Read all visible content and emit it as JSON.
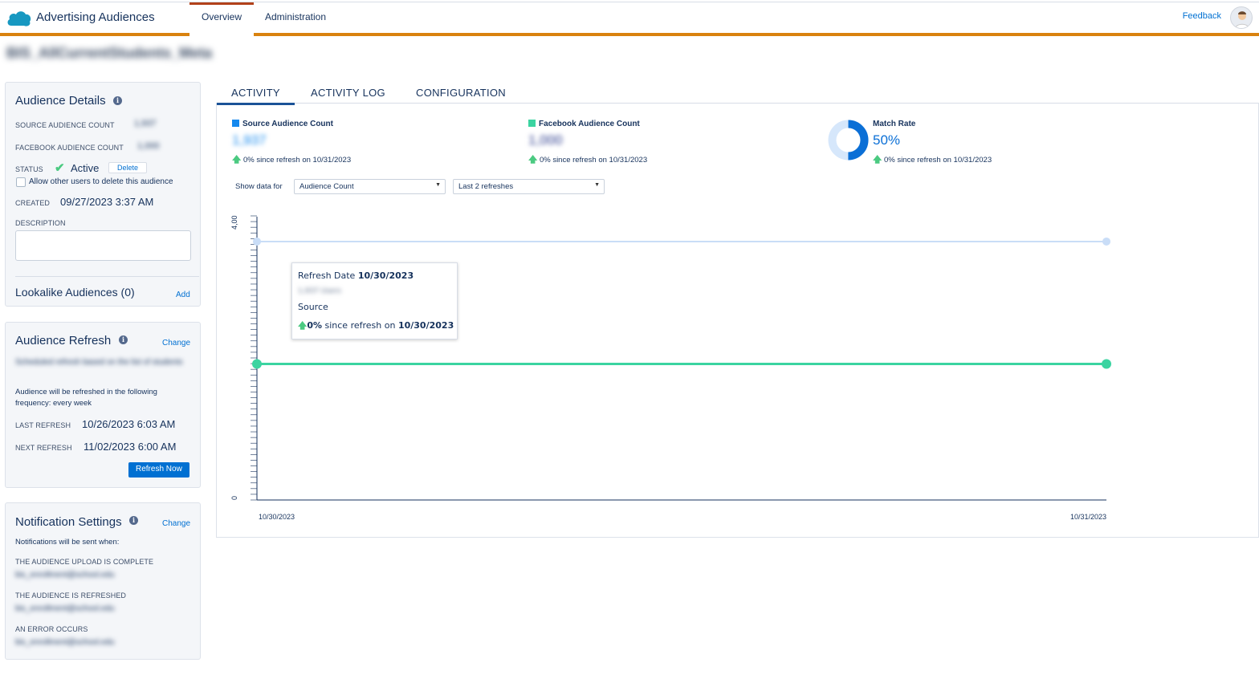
{
  "header": {
    "app_title": "Advertising Audiences",
    "tabs": [
      {
        "label": "Overview"
      },
      {
        "label": "Administration"
      }
    ],
    "feedback": "Feedback"
  },
  "page_title": "BIS_AllCurrentStudents_Meta",
  "audience_details": {
    "title": "Audience Details",
    "source_count_label": "SOURCE AUDIENCE COUNT",
    "source_count_value": "1,937",
    "facebook_count_label": "FACEBOOK AUDIENCE COUNT",
    "facebook_count_value": "1,000",
    "status_label": "STATUS",
    "status_value": "Active",
    "delete_label": "Delete",
    "allow_delete_label": "Allow other users to delete this audience",
    "created_label": "CREATED",
    "created_value": "09/27/2023 3:37 AM",
    "description_label": "DESCRIPTION",
    "lookalike_label": "Lookalike Audiences (0)",
    "add_label": "Add"
  },
  "audience_refresh": {
    "title": "Audience Refresh",
    "change_label": "Change",
    "blurred_text": "Scheduled refresh based on the list of students",
    "frequency_text": "Audience will be refreshed in the following frequency: every week",
    "last_refresh_label": "LAST REFRESH",
    "last_refresh_value": "10/26/2023 6:03 AM",
    "next_refresh_label": "NEXT REFRESH",
    "next_refresh_value": "11/02/2023 6:00 AM",
    "refresh_now_label": "Refresh Now"
  },
  "notification_settings": {
    "title": "Notification Settings",
    "change_label": "Change",
    "intro": "Notifications will be sent when:",
    "upload_label": "THE AUDIENCE UPLOAD IS COMPLETE",
    "upload_value": "bis_enrollment@school.edu",
    "refreshed_label": "THE AUDIENCE IS REFRESHED",
    "refreshed_value": "bis_enrollment@school.edu",
    "error_label": "AN ERROR OCCURS",
    "error_value": "bis_enrollment@school.edu"
  },
  "main_tabs": [
    {
      "label": "ACTIVITY"
    },
    {
      "label": "ACTIVITY LOG"
    },
    {
      "label": "CONFIGURATION"
    }
  ],
  "stats": {
    "source": {
      "title": "Source Audience Count",
      "value": "1,937",
      "change": "0% since refresh on 10/31/2023",
      "color": "#1589ee"
    },
    "facebook": {
      "title": "Facebook Audience Count",
      "value": "1,000",
      "change": "0% since refresh on 10/31/2023",
      "color": "#3bd4a1"
    },
    "match": {
      "title": "Match Rate",
      "value": "50%",
      "change": "0% since refresh on 10/31/2023",
      "color": "#0b6fd6",
      "fraction": 0.5
    }
  },
  "filters": {
    "show_data_label": "Show data for",
    "metric": "Audience Count",
    "range": "Last 2 refreshes"
  },
  "chart_data": {
    "type": "line",
    "x": [
      "10/30/2023",
      "10/31/2023"
    ],
    "y_tick_labels": [
      "0",
      "4,00"
    ],
    "series": [
      {
        "values": [
          3800,
          3800
        ],
        "color": "#c9ddf7"
      },
      {
        "values": [
          2000,
          2000
        ],
        "color": "#3bd4a1"
      }
    ],
    "ylim": [
      0,
      4000
    ]
  },
  "tooltip": {
    "title_prefix": "Refresh Date",
    "title_date": "10/30/2023",
    "blurred": "1,937 Users",
    "series_name": "Source",
    "change_pct": "0%",
    "change_text": "since refresh on",
    "change_date": "10/30/2023"
  }
}
